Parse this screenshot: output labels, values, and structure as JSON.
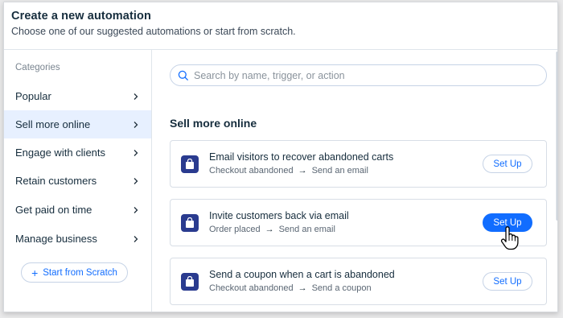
{
  "header": {
    "title": "Create a new automation",
    "subtitle": "Choose one of our suggested automations or start from scratch."
  },
  "sidebar": {
    "categories_label": "Categories",
    "items": [
      {
        "label": "Popular"
      },
      {
        "label": "Sell more online"
      },
      {
        "label": "Engage with clients"
      },
      {
        "label": "Retain customers"
      },
      {
        "label": "Get paid on time"
      },
      {
        "label": "Manage business"
      }
    ],
    "active_index": 1,
    "start_scratch_label": "Start from Scratch"
  },
  "search": {
    "placeholder": "Search by name, trigger, or action"
  },
  "main": {
    "section_title": "Sell more online",
    "cards": [
      {
        "title": "Email visitors to recover abandoned carts",
        "trigger": "Checkout abandoned",
        "action": "Send an email",
        "button": "Set Up"
      },
      {
        "title": "Invite customers back via email",
        "trigger": "Order placed",
        "action": "Send an email",
        "button": "Set Up"
      },
      {
        "title": "Send a coupon when a cart is abandoned",
        "trigger": "Checkout abandoned",
        "action": "Send a coupon",
        "button": "Set Up"
      }
    ]
  },
  "icons": {
    "card_icon": "shopping-bag-icon",
    "cursor": "hand-pointer-icon"
  },
  "colors": {
    "accent": "#116dff",
    "active_bg": "#e7f0ff",
    "icon_bg": "#2a3b8f"
  }
}
